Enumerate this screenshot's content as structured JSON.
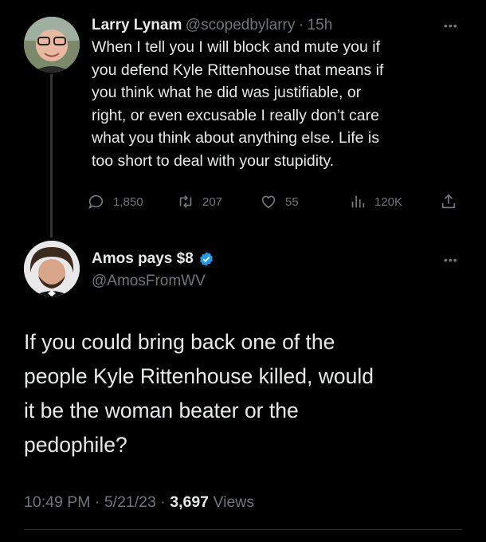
{
  "parent_tweet": {
    "name": "Larry Lynam",
    "handle": "@scopedbylarry",
    "sep": "·",
    "time": "15h",
    "text_lines": [
      "When I tell you I will block and mute you if",
      "you defend Kyle Rittenhouse that means if",
      "you think what he did was justifiable, or",
      "right, or even excusable I really don’t care",
      "what you think about anything else. Life is",
      "too short to deal with your stupidity."
    ],
    "replies": "1,850",
    "retweets": "207",
    "likes": "55",
    "views": "120K"
  },
  "reply_tweet": {
    "name": "Amos pays $8",
    "handle": "@AmosFromWV",
    "verified_color": "#1d9bf0",
    "text_lines": [
      "If you could bring back one of the",
      "people Kyle Rittenhouse killed, would",
      "it be the woman beater or the",
      "pedophile?"
    ],
    "time": "10:49 PM",
    "dot1": "·",
    "date": "5/21/23",
    "dot2": "·",
    "views_count": "3,697",
    "views_label": "Views"
  },
  "more_glyph": "•••"
}
